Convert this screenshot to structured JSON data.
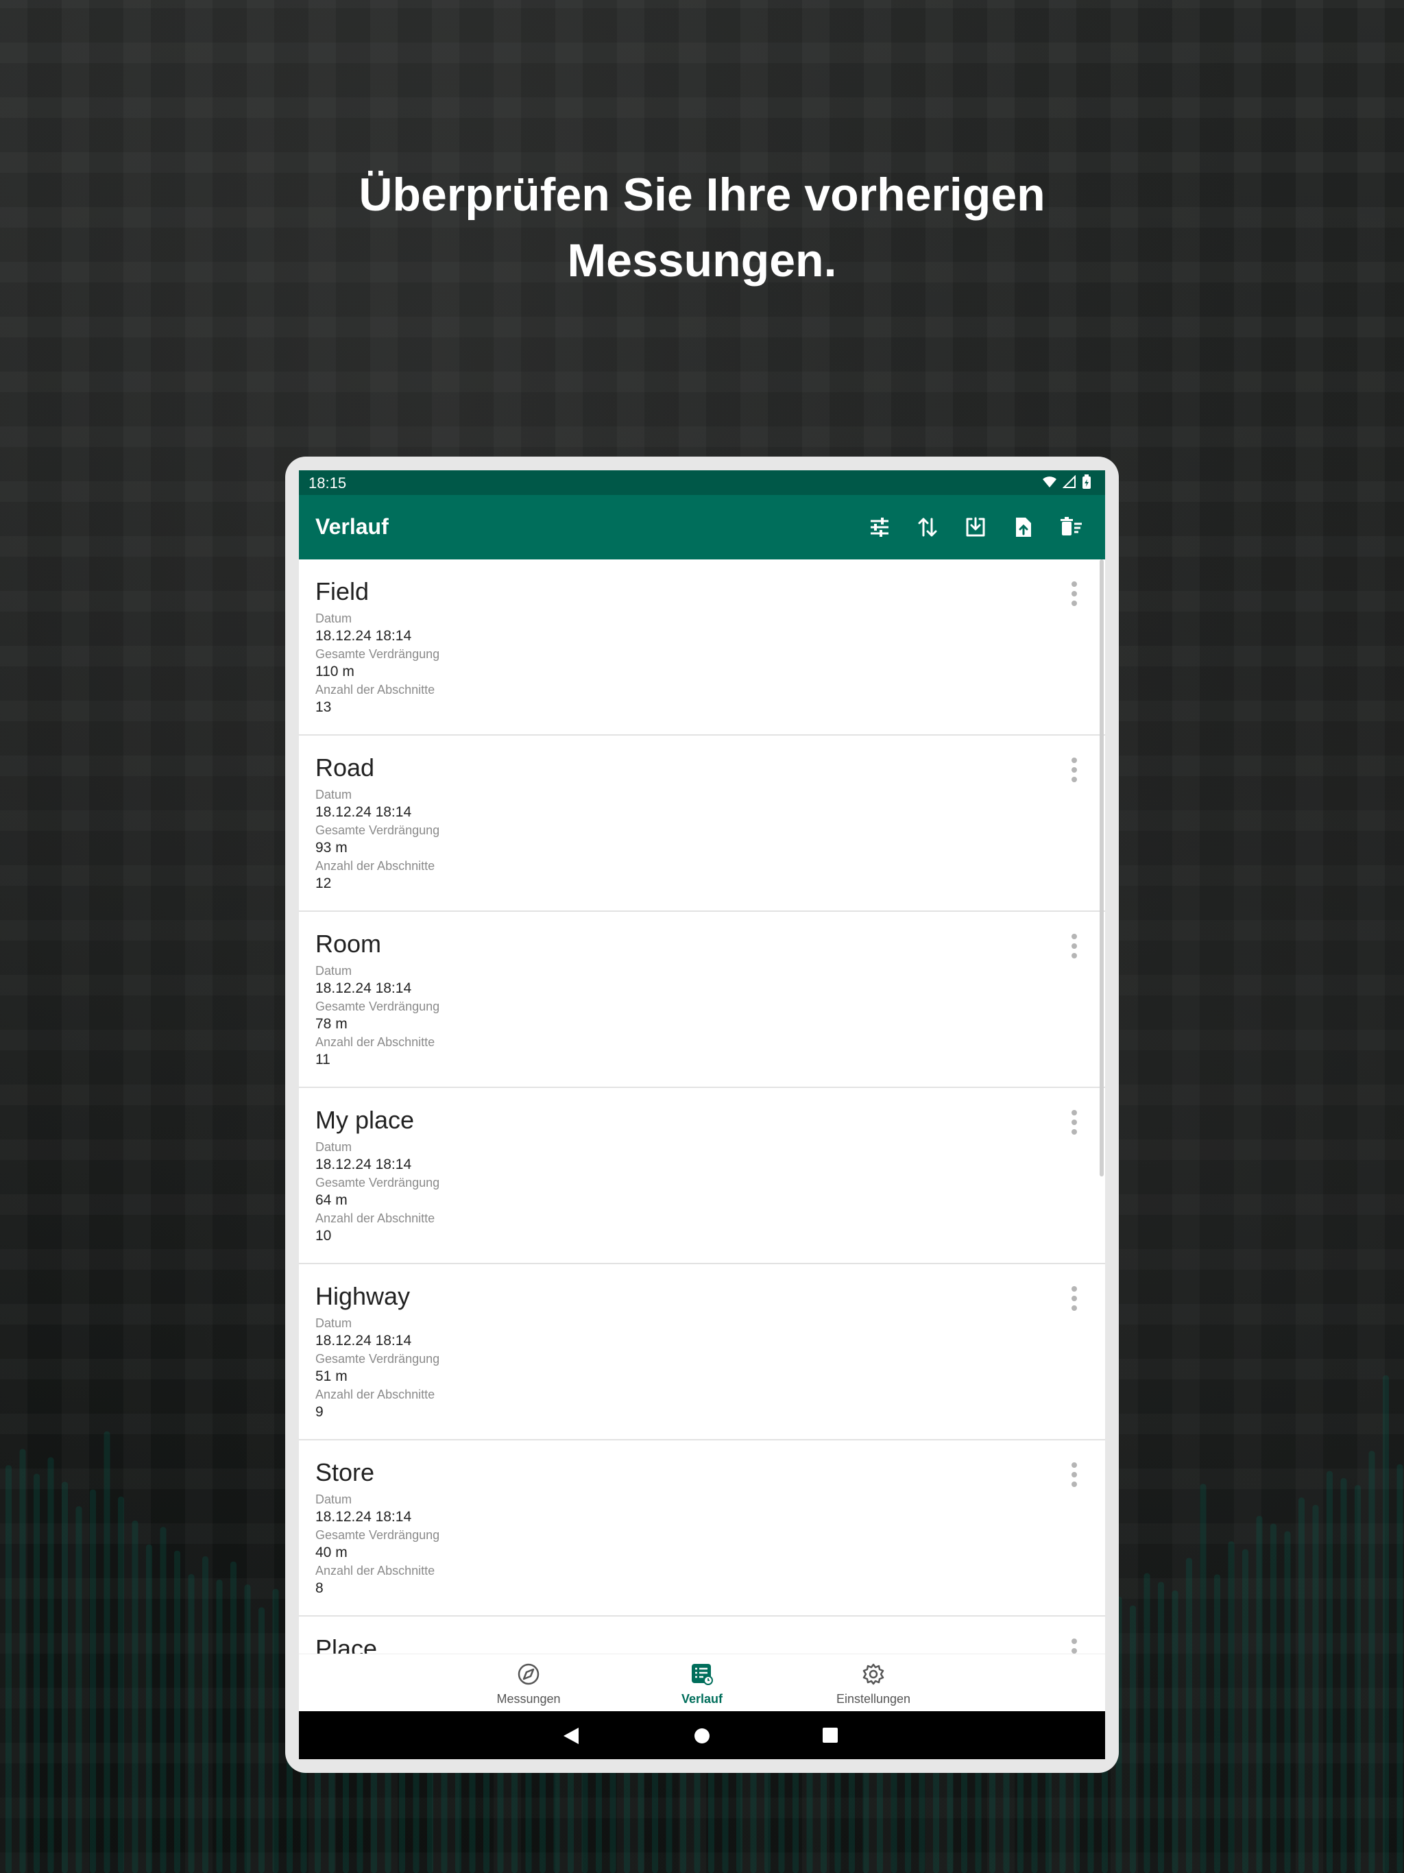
{
  "headline": {
    "line1": "Überprüfen Sie Ihre vorherigen",
    "line2": "Messungen."
  },
  "status_bar": {
    "time": "18:15",
    "icons": [
      "wifi-icon",
      "signal-icon",
      "battery-icon"
    ]
  },
  "app_bar": {
    "title": "Verlauf",
    "actions": [
      "filter-icon",
      "sort-icon",
      "download-icon",
      "export-file-icon",
      "delete-all-icon"
    ]
  },
  "labels": {
    "date": "Datum",
    "total": "Gesamte Verdrängung",
    "segments": "Anzahl der Abschnitte"
  },
  "measurements": [
    {
      "name": "Field",
      "date_label": "Datum",
      "date": "18.12.24 18:14",
      "total_label": "Gesamte Verdrängung",
      "total": "110 m",
      "segments_label": "Anzahl der Abschnitte",
      "segments": "13"
    },
    {
      "name": "Road",
      "date_label": "Datum",
      "date": "18.12.24 18:14",
      "total_label": "Gesamte Verdrängung",
      "total": "93 m",
      "segments_label": "Anzahl der Abschnitte",
      "segments": "12"
    },
    {
      "name": "Room",
      "date_label": "Datum",
      "date": "18.12.24 18:14",
      "total_label": "Gesamte Verdrängung",
      "total": "78 m",
      "segments_label": "Anzahl der Abschnitte",
      "segments": "11"
    },
    {
      "name": "My place",
      "date_label": "Datum",
      "date": "18.12.24 18:14",
      "total_label": "Gesamte Verdrängung",
      "total": "64 m",
      "segments_label": "Anzahl der Abschnitte",
      "segments": "10"
    },
    {
      "name": "Highway",
      "date_label": "Datum",
      "date": "18.12.24 18:14",
      "total_label": "Gesamte Verdrängung",
      "total": "51 m",
      "segments_label": "Anzahl der Abschnitte",
      "segments": "9"
    },
    {
      "name": "Store",
      "date_label": "Datum",
      "date": "18.12.24 18:14",
      "total_label": "Gesamte Verdrängung",
      "total": "40 m",
      "segments_label": "Anzahl der Abschnitte",
      "segments": "8"
    },
    {
      "name": "Place",
      "date_label": "",
      "date": "",
      "total_label": "",
      "total": "",
      "segments_label": "",
      "segments": ""
    }
  ],
  "bottom_nav": [
    {
      "label": "Messungen",
      "icon": "compass-icon",
      "active": false
    },
    {
      "label": "Verlauf",
      "icon": "history-list-icon",
      "active": true
    },
    {
      "label": "Einstellungen",
      "icon": "gear-icon",
      "active": false
    }
  ],
  "colors": {
    "primary": "#006e5b",
    "status_bar": "#005848",
    "text_primary": "#222222",
    "text_secondary": "#8a8a8a"
  }
}
